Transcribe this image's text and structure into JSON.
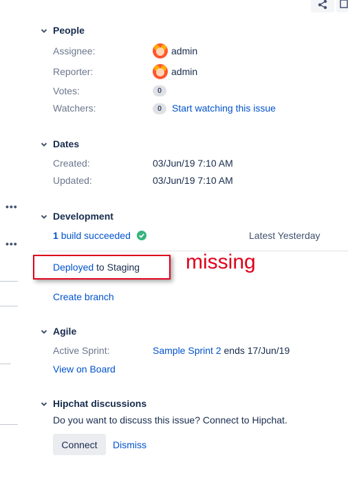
{
  "people": {
    "heading": "People",
    "assignee_label": "Assignee:",
    "assignee_value": "admin",
    "reporter_label": "Reporter:",
    "reporter_value": "admin",
    "votes_label": "Votes:",
    "votes_count": "0",
    "watchers_label": "Watchers:",
    "watchers_count": "0",
    "watch_link": "Start watching this issue"
  },
  "dates": {
    "heading": "Dates",
    "created_label": "Created:",
    "created_value": "03/Jun/19 7:10 AM",
    "updated_label": "Updated:",
    "updated_value": "03/Jun/19 7:10 AM"
  },
  "development": {
    "heading": "Development",
    "build_count": "1",
    "build_text": "build succeeded",
    "latest_text": "Latest Yesterday",
    "deployed_link": "Deployed",
    "deployed_rest": "to Staging",
    "create_branch": "Create branch"
  },
  "annotation": {
    "text": "missing"
  },
  "agile": {
    "heading": "Agile",
    "active_sprint_label": "Active Sprint:",
    "sprint_link": "Sample Sprint 2",
    "sprint_rest": "ends 17/Jun/19",
    "view_board": "View on Board"
  },
  "hipchat": {
    "heading": "Hipchat discussions",
    "prompt": "Do you want to discuss this issue? Connect to Hipchat.",
    "connect_button": "Connect",
    "dismiss_link": "Dismiss"
  },
  "icons": {
    "share": "share-icon",
    "expand": "expand-icon",
    "chevron": "chevron-down-icon",
    "more": "more-icon",
    "success": "check-circle-icon"
  },
  "colors": {
    "link": "#0052cc",
    "success": "#36b37e",
    "annotation": "#e0001b"
  }
}
